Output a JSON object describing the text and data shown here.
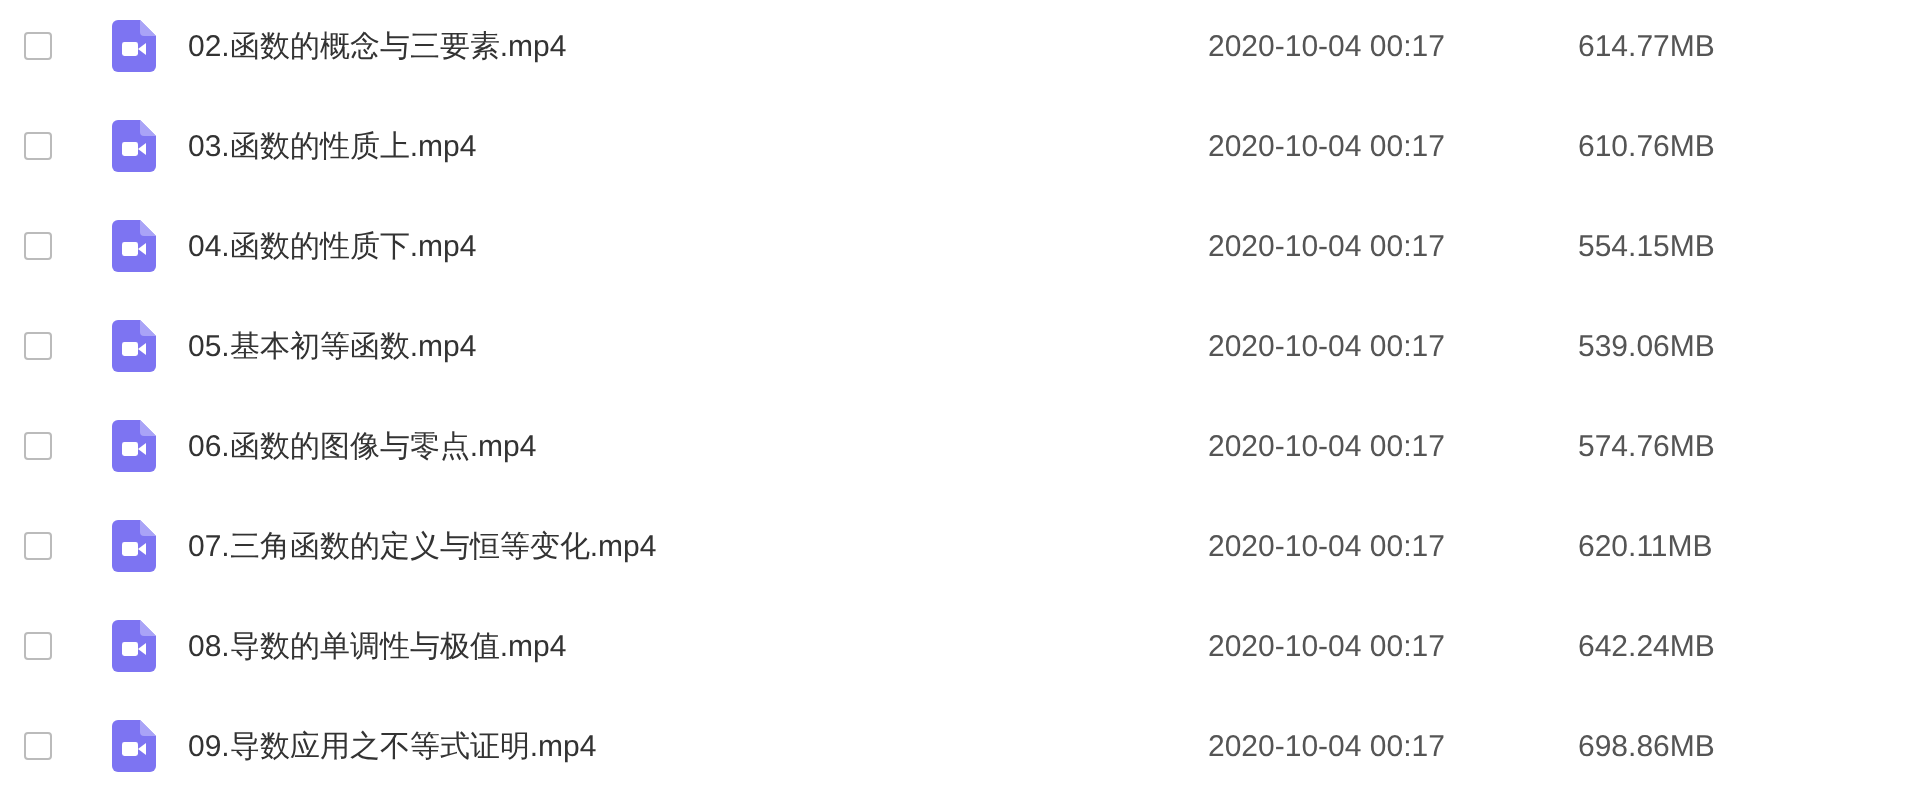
{
  "files": [
    {
      "name": "02.函数的概念与三要素.mp4",
      "modified": "2020-10-04 00:17",
      "size": "614.77MB",
      "checked": false
    },
    {
      "name": "03.函数的性质上.mp4",
      "modified": "2020-10-04 00:17",
      "size": "610.76MB",
      "checked": false
    },
    {
      "name": "04.函数的性质下.mp4",
      "modified": "2020-10-04 00:17",
      "size": "554.15MB",
      "checked": false
    },
    {
      "name": "05.基本初等函数.mp4",
      "modified": "2020-10-04 00:17",
      "size": "539.06MB",
      "checked": false
    },
    {
      "name": "06.函数的图像与零点.mp4",
      "modified": "2020-10-04 00:17",
      "size": "574.76MB",
      "checked": false
    },
    {
      "name": "07.三角函数的定义与恒等变化.mp4",
      "modified": "2020-10-04 00:17",
      "size": "620.11MB",
      "checked": false
    },
    {
      "name": "08.导数的单调性与极值.mp4",
      "modified": "2020-10-04 00:17",
      "size": "642.24MB",
      "checked": false
    },
    {
      "name": "09.导数应用之不等式证明.mp4",
      "modified": "2020-10-04 00:17",
      "size": "698.86MB",
      "checked": false
    }
  ]
}
